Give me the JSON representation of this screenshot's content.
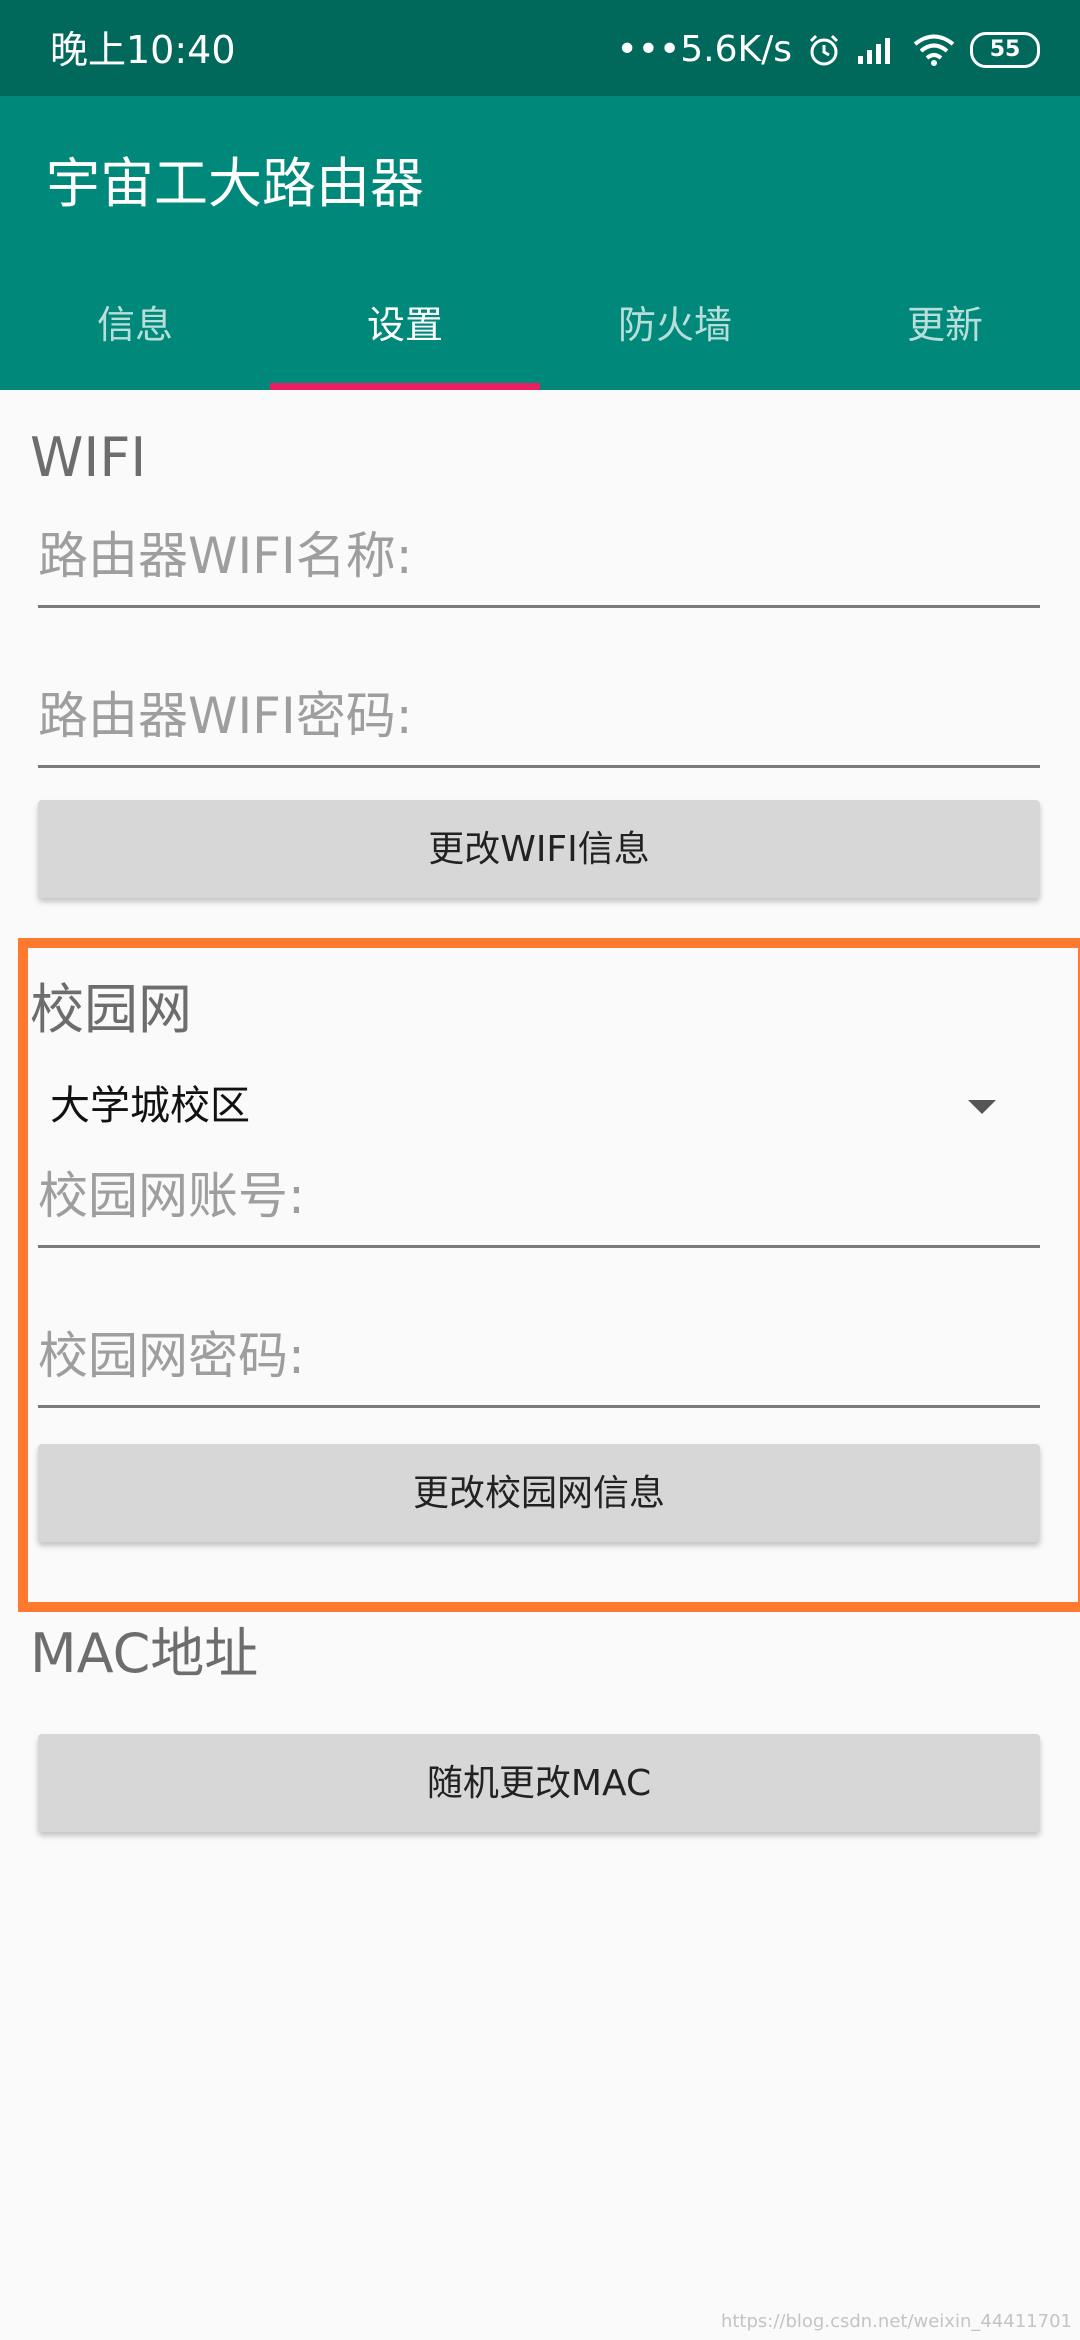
{
  "status_bar": {
    "time": "晚上10:40",
    "network": "•••5.6K/s",
    "battery": "55"
  },
  "app": {
    "title": "宇宙工大路由器"
  },
  "tabs": [
    {
      "label": "信息",
      "active": false
    },
    {
      "label": "设置",
      "active": true
    },
    {
      "label": "防火墙",
      "active": false
    },
    {
      "label": "更新",
      "active": false
    }
  ],
  "wifi": {
    "title": "WIFI",
    "name_placeholder": "路由器WIFI名称:",
    "password_placeholder": "路由器WIFI密码:",
    "button": "更改WIFI信息"
  },
  "campus": {
    "title": "校园网",
    "campus_selected": "大学城校区",
    "account_placeholder": "校园网账号:",
    "password_placeholder": "校园网密码:",
    "button": "更改校园网信息"
  },
  "mac": {
    "title": "MAC地址",
    "button": "随机更改MAC"
  },
  "watermark": "https://blog.csdn.net/weixin_44411701",
  "colors": {
    "status_bar": "#00695c",
    "app_bar": "#00897b",
    "tab_indicator": "#e91e63",
    "highlight": "#ff7a2e",
    "button": "#d7d7d7",
    "background": "#fafafa"
  }
}
